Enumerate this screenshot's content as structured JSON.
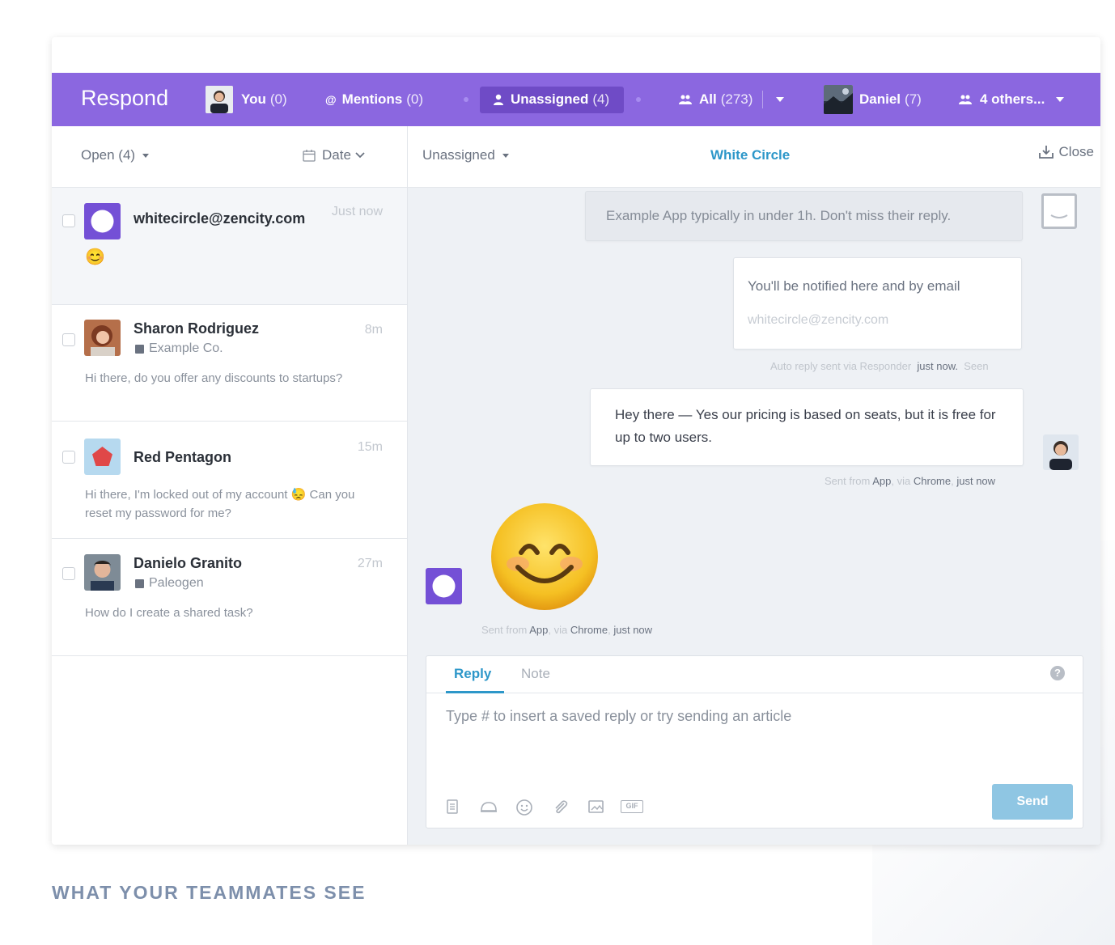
{
  "topbar": {
    "brand": "Respond",
    "tabs": [
      {
        "label": "You",
        "count": "(0)"
      },
      {
        "label": "Mentions",
        "count": "(0)"
      },
      {
        "label": "Unassigned",
        "count": "(4)"
      },
      {
        "label": "All",
        "count": "(273)"
      },
      {
        "label": "Daniel",
        "count": "(7)"
      },
      {
        "label": "4 others...",
        "count": ""
      }
    ],
    "accent_color": "#8b67e0"
  },
  "list": {
    "filter_status": "Open (4)",
    "sort": "Date",
    "conversations": [
      {
        "name": "whitecircle@zencity.com",
        "time": "Just now",
        "message": "😊"
      },
      {
        "name": "Sharon Rodriguez",
        "company": "Example Co.",
        "time": "8m",
        "message": "Hi there, do you offer any discounts to startups?"
      },
      {
        "name": "Red Pentagon",
        "time": "15m",
        "message_a": "Hi there, I'm locked out of my account",
        "message_b": "Can you reset my password for me?"
      },
      {
        "name": "Danielo Granito",
        "company": "Paleogen",
        "time": "27m",
        "message": "How do I create a shared task?"
      }
    ]
  },
  "conversation": {
    "assignee": "Unassigned",
    "title": "White Circle",
    "close_label": "Close",
    "auto_reply": "Example App typically in under 1h. Don't miss their reply.",
    "notify_text": "You'll be notified here and by email",
    "notify_email": "whitecircle@zencity.com",
    "meta1_prefix": "Auto reply sent via Responder",
    "meta1_time": "just now.",
    "meta1_status": "Seen",
    "agent_message": "Hey there — Yes our pricing is based on seats, but it is free for up to two users.",
    "meta2_prefix": "Sent from",
    "meta2_app": "App",
    "meta2_via": ", via",
    "meta2_browser": "Chrome",
    "meta2_time": "just now",
    "meta3_prefix": "Sent from",
    "meta3_app": "App",
    "meta3_via": ", via",
    "meta3_browser": "Chrome",
    "meta3_time": "just now"
  },
  "composer": {
    "tab_reply": "Reply",
    "tab_note": "Note",
    "placeholder": "Type # to insert a saved reply or try sending an article",
    "send_label": "Send",
    "help_label": "?",
    "gif_label": "GIF"
  },
  "caption": "WHAT YOUR TEAMMATES SEE"
}
